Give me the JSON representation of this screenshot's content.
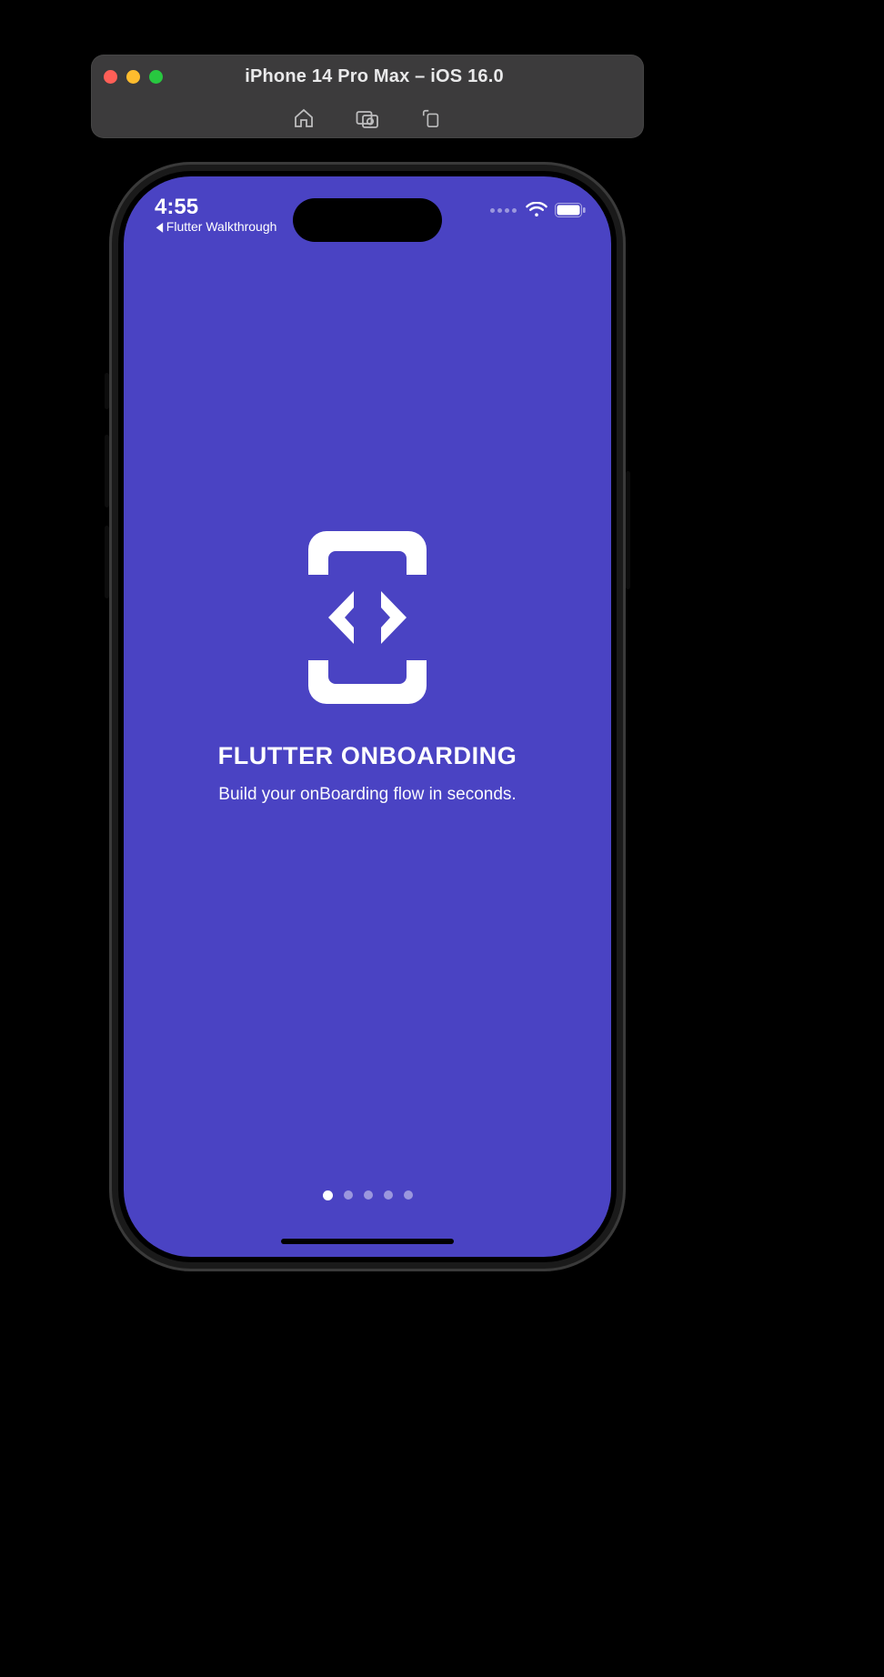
{
  "simulator": {
    "title": "iPhone 14 Pro Max – iOS 16.0"
  },
  "status": {
    "time": "4:55",
    "back_label": "Flutter Walkthrough"
  },
  "onboarding": {
    "title": "FLUTTER ONBOARDING",
    "subtitle": "Build your onBoarding flow in seconds.",
    "page_count": 5,
    "active_page": 0
  },
  "colors": {
    "app_background": "#4a43c3"
  }
}
